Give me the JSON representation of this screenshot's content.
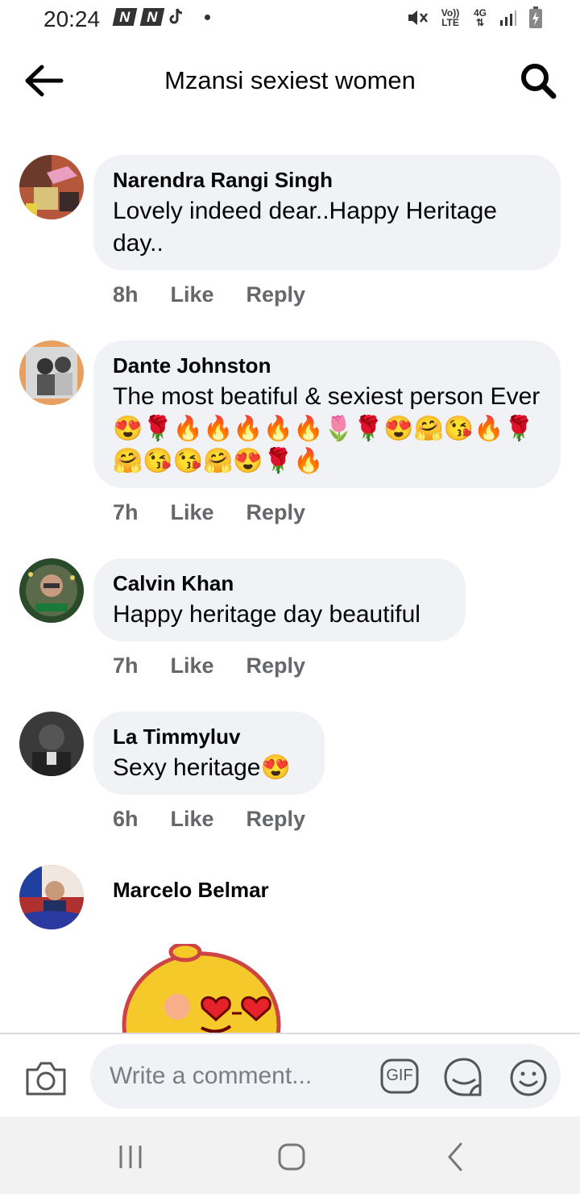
{
  "status_bar": {
    "time": "20:24",
    "n_label": "N",
    "volte_label": "Vo)) LTE",
    "network_label": "4G"
  },
  "header": {
    "title": "Mzansi sexiest women"
  },
  "comments": [
    {
      "author": "Narendra Rangi Singh",
      "text": "Lovely indeed dear..Happy Heritage day..",
      "time": "8h",
      "like": "Like",
      "reply": "Reply"
    },
    {
      "author": "Dante Johnston",
      "text": "The most beatiful & sexiest person Ever😍🌹🔥🔥🔥🔥🔥🌷🌹😍🤗😘🔥🌹🤗😘😘🤗😍🌹🔥",
      "time": "7h",
      "like": "Like",
      "reply": "Reply"
    },
    {
      "author": "Calvin Khan",
      "text": "Happy heritage day beautiful",
      "time": "7h",
      "like": "Like",
      "reply": "Reply"
    },
    {
      "author": "La Timmyluv",
      "text": "Sexy heritage😍",
      "time": "6h",
      "like": "Like",
      "reply": "Reply"
    },
    {
      "author": "Marcelo Belmar"
    }
  ],
  "composer": {
    "placeholder": "Write a comment...",
    "gif_label": "GIF"
  },
  "colors": {
    "bubble": "#f0f2f5",
    "secondary_text": "#65676b",
    "primary_text": "#050505"
  }
}
